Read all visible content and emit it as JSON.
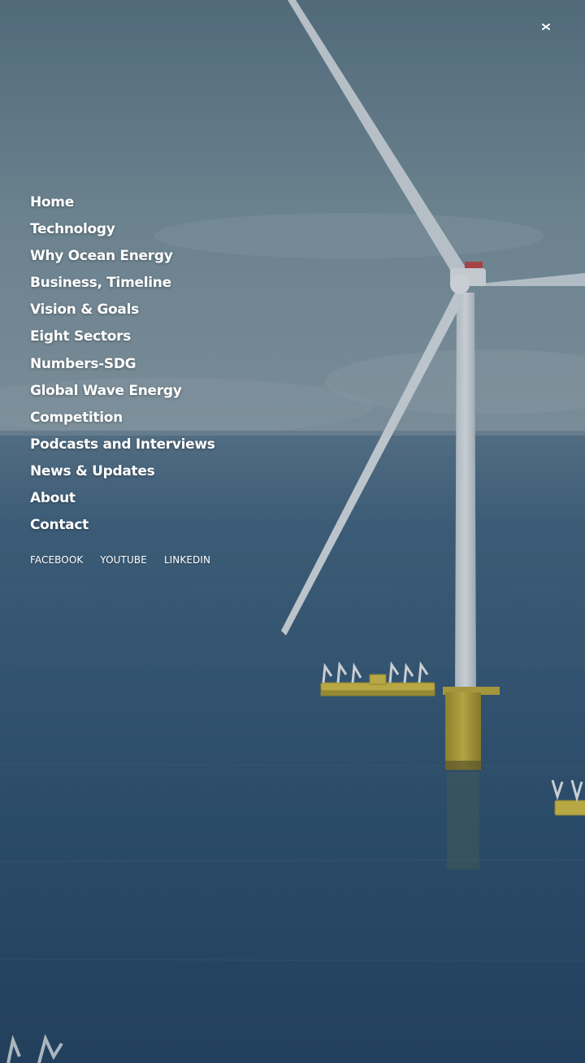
{
  "menu": {
    "items": [
      {
        "label": "Home"
      },
      {
        "label": "Technology"
      },
      {
        "label": "Why Ocean Energy"
      },
      {
        "label": "Business, Timeline"
      },
      {
        "label": "Vision & Goals"
      },
      {
        "label": "Eight Sectors"
      },
      {
        "label": "Numbers-SDG"
      },
      {
        "label": "Global Wave Energy"
      },
      {
        "label": "Competition"
      },
      {
        "label": "Podcasts and Interviews"
      },
      {
        "label": "News & Updates"
      },
      {
        "label": "About"
      },
      {
        "label": "Contact"
      }
    ]
  },
  "social": {
    "facebook": "FACEBOOK",
    "youtube": "YOUTUBE",
    "linkedin": "LINKEDIN"
  },
  "icons": {
    "close": "close-icon"
  },
  "colors": {
    "sky": "#6f8a9a",
    "sea": "#2f4f71",
    "text": "#ffffff",
    "tower": "#e6ebee",
    "foundation": "#c9b23a"
  }
}
